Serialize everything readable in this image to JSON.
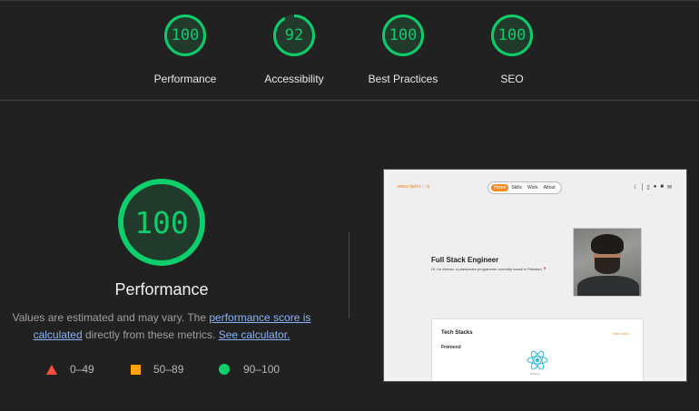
{
  "categories": [
    {
      "label": "Performance",
      "score": "100",
      "value": 100
    },
    {
      "label": "Accessibility",
      "score": "92",
      "value": 92
    },
    {
      "label": "Best Practices",
      "score": "100",
      "value": 100
    },
    {
      "label": "SEO",
      "score": "100",
      "value": 100
    }
  ],
  "main": {
    "score": "100",
    "title": "Performance",
    "desc_part1": "Values are estimated and may vary. The ",
    "desc_link1": "performance score is calculated",
    "desc_part2": " directly from these metrics. ",
    "desc_link2": "See calculator."
  },
  "legend": {
    "fail": "0–49",
    "average": "50–89",
    "pass": "90–100"
  },
  "colors": {
    "pass": "#0cce6b",
    "average": "#ffa400",
    "fail": "#ff4e42",
    "link": "#8ab4f8"
  },
  "screenshot": {
    "brand": "ammar@dev:~$",
    "nav": [
      "Home",
      "Skills",
      "Work",
      "About"
    ],
    "hero_title": "Full Stack Engineer",
    "hero_sub": "Hi, I'm Ammar, a passionate programmer currently based in Pakistan",
    "card_title": "Tech Stacks",
    "card_more": "See more...",
    "card_section": "Frontend",
    "react_label": "React.js"
  }
}
